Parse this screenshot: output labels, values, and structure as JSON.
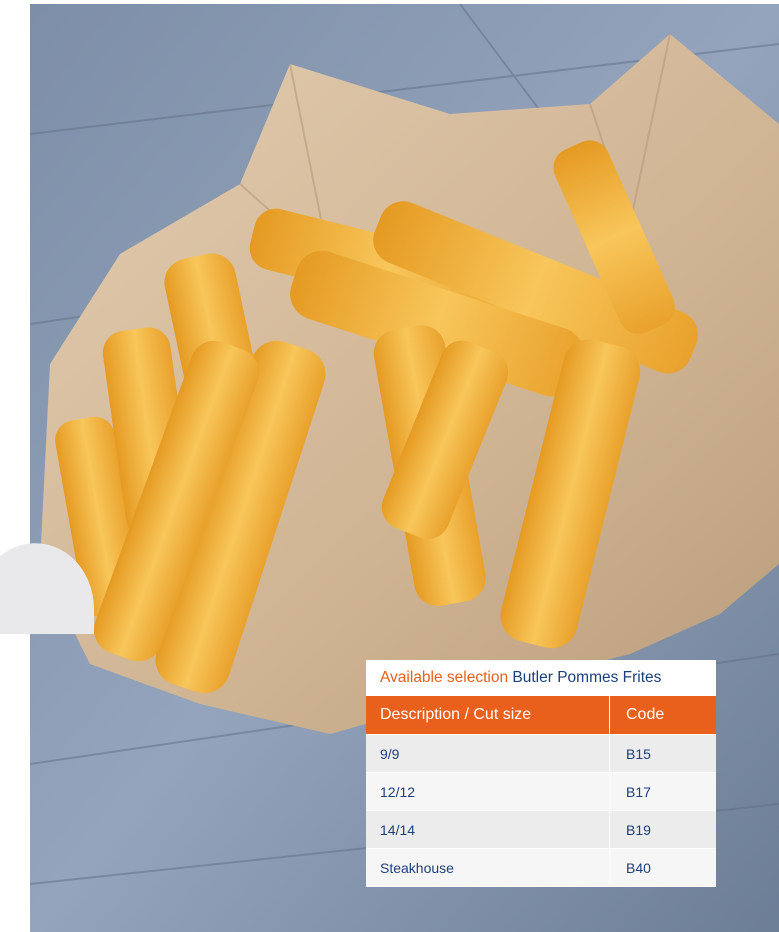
{
  "image": {
    "subject": "fries-photo",
    "colors": {
      "board": "#8a9bb3",
      "paper": "#d8bfa2",
      "fry": "#f2b23a",
      "accent": "#e8601c",
      "brand": "#1d3f7a"
    }
  },
  "table": {
    "title_accent": "Available selection",
    "title_brand": "Butler Pommes Frites",
    "headers": {
      "description": "Description / Cut size",
      "code": "Code"
    },
    "rows": [
      {
        "description": "9/9",
        "code": "B15"
      },
      {
        "description": "12/12",
        "code": "B17"
      },
      {
        "description": "14/14",
        "code": "B19"
      },
      {
        "description": "Steakhouse",
        "code": "B40"
      }
    ]
  }
}
